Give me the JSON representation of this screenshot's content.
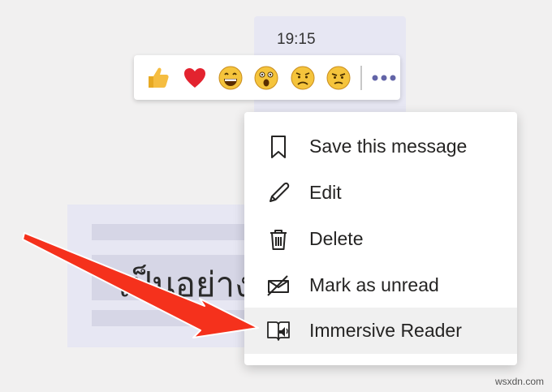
{
  "message": {
    "timestamp": "19:15",
    "preview_text": "เป็นอย่าง"
  },
  "reactions": [
    {
      "name": "like",
      "icon": "thumbs-up-icon"
    },
    {
      "name": "heart",
      "icon": "heart-icon"
    },
    {
      "name": "laugh",
      "icon": "laugh-icon"
    },
    {
      "name": "surprised",
      "icon": "surprised-icon"
    },
    {
      "name": "sad",
      "icon": "sad-icon"
    },
    {
      "name": "angry",
      "icon": "angry-icon"
    }
  ],
  "more_options": {
    "icon": "more-options-icon"
  },
  "menu": {
    "items": [
      {
        "label": "Save this message",
        "icon": "bookmark-icon"
      },
      {
        "label": "Edit",
        "icon": "pencil-icon"
      },
      {
        "label": "Delete",
        "icon": "trash-icon"
      },
      {
        "label": "Mark as unread",
        "icon": "unread-icon"
      },
      {
        "label": "Immersive Reader",
        "icon": "immersive-reader-icon",
        "highlighted": true
      }
    ]
  },
  "annotation": {
    "color": "#f5311c",
    "icon": "red-arrow"
  },
  "watermark": "wsxdn.com",
  "colors": {
    "accent": "#6264a7",
    "bubble": "#e7e7f3",
    "background": "#f1f0f0"
  }
}
